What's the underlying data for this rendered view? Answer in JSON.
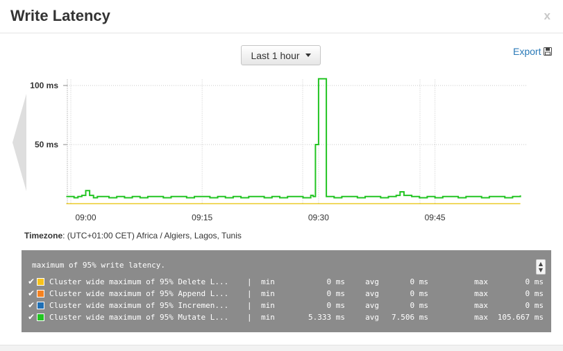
{
  "dialog": {
    "title": "Write Latency",
    "close_label": "x"
  },
  "controls": {
    "time_range": "Last 1 hour",
    "export_label": "Export"
  },
  "timezone": {
    "label": "Timezone",
    "value": ": (UTC+01:00 CET) Africa / Algiers, Lagos, Tunis"
  },
  "colors": {
    "series_line": "#22c422",
    "baseline": "#e8c000",
    "grid": "#c8c8c8"
  },
  "chart_data": {
    "type": "line",
    "title": "",
    "xlabel": "",
    "ylabel": "",
    "x_ticks": [
      "09:00",
      "09:15",
      "09:30",
      "09:45"
    ],
    "y_ticks": [
      "50 ms",
      "100 ms"
    ],
    "y_tick_values": [
      50,
      100
    ],
    "ylim": [
      0,
      105.667
    ],
    "x_range_minutes": [
      0,
      56
    ],
    "grid": true,
    "series": [
      {
        "name": "Cluster wide maximum of 95% Mutate L...",
        "color": "#22c422",
        "x_minutes": [
          -2.5,
          -2,
          -1.5,
          -1,
          -0.5,
          0,
          0.5,
          1,
          1.5,
          2,
          3,
          4,
          5,
          6,
          7,
          8,
          9,
          10,
          11,
          12,
          13,
          14,
          15,
          16,
          17,
          18,
          19,
          20,
          21,
          22,
          23,
          24,
          25,
          26,
          27,
          28,
          29,
          29.3,
          29.6,
          30,
          30.4,
          30.8,
          31,
          32,
          33,
          34,
          35,
          36,
          37,
          38,
          39,
          40,
          40.5,
          41,
          42,
          43,
          44,
          45,
          46,
          47,
          48,
          49,
          50,
          51,
          52,
          53,
          54,
          55,
          56
        ],
        "values": [
          6,
          6,
          5,
          6,
          7,
          11,
          7,
          5,
          6,
          6,
          5,
          6,
          5,
          6,
          5,
          6,
          6,
          5,
          6,
          6,
          5,
          6,
          6,
          5,
          6,
          5,
          6,
          5,
          6,
          6,
          5,
          6,
          5,
          6,
          6,
          5,
          7,
          6,
          50,
          105.667,
          105.667,
          105.667,
          6,
          5,
          6,
          6,
          5,
          6,
          6,
          5,
          6,
          7,
          10,
          7,
          6,
          5,
          6,
          5,
          6,
          6,
          5,
          6,
          6,
          5,
          6,
          6,
          5,
          6,
          7
        ]
      },
      {
        "name": "Cluster wide maximum of 95% Delete L...",
        "color": "#e8c000",
        "x_minutes": [
          -2.5,
          56
        ],
        "values": [
          0,
          0
        ]
      }
    ]
  },
  "legend": {
    "title": "maximum of 95% write latency.",
    "rows": [
      {
        "name": "Cluster wide maximum of 95% Delete L...",
        "sep": "|",
        "min_label": "min",
        "min": "0 ms",
        "avg_label": "avg",
        "avg": "0 ms",
        "max_label": "max",
        "max": "0 ms",
        "color": "#f7c21b"
      },
      {
        "name": "Cluster wide maximum of 95% Append L...",
        "sep": "|",
        "min_label": "min",
        "min": "0 ms",
        "avg_label": "avg",
        "avg": "0 ms",
        "max_label": "max",
        "max": "0 ms",
        "color": "#f58220"
      },
      {
        "name": "Cluster wide maximum of 95% Incremen...",
        "sep": "|",
        "min_label": "min",
        "min": "0 ms",
        "avg_label": "avg",
        "avg": "0 ms",
        "max_label": "max",
        "max": "0 ms",
        "color": "#1f6fb5"
      },
      {
        "name": "Cluster wide maximum of 95% Mutate L...",
        "sep": "|",
        "min_label": "min",
        "min": "5.333 ms",
        "avg_label": "avg",
        "avg": "7.506 ms",
        "max_label": "max",
        "max": "105.667 ms",
        "color": "#22c422"
      }
    ]
  }
}
